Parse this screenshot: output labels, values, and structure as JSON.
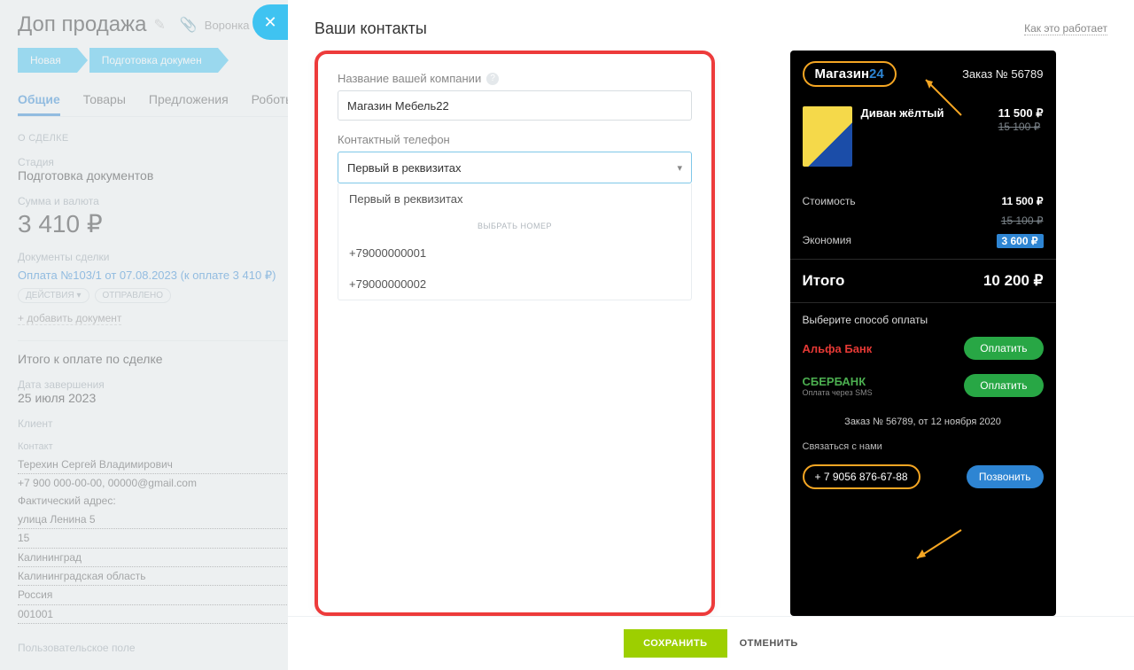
{
  "bg": {
    "title": "Доп продажа",
    "funnel": "Воронка отдела прода",
    "stages": [
      "Новая",
      "Подготовка докумен"
    ],
    "tabs": [
      "Общие",
      "Товары",
      "Предложения",
      "Роботы"
    ],
    "section": "О СДЕЛКЕ",
    "stage_lbl": "Стадия",
    "stage_val": "Подготовка документов",
    "sum_lbl": "Сумма и валюта",
    "sum_val": "3 410 ₽",
    "docs_lbl": "Документы сделки",
    "doc_link": "Оплата №103/1 от 07.08.2023 (к оплате 3 410 ₽)",
    "chip1": "ДЕЙСТВИЯ ▾",
    "chip2": "ОТПРАВЛЕНО",
    "add_doc": "+ добавить документ",
    "total_lbl": "Итого к оплате по сделке",
    "date_lbl": "Дата завершения",
    "date_val": "25 июля 2023",
    "client_lbl": "Клиент",
    "contact_lbl": "Контакт",
    "contact_name": "Терехин Сергей Владимирович",
    "contact_phone": "+7 900 000-00-00, 00000@gmail.com",
    "addr_lbl": "Фактический адрес:",
    "addr": [
      "улица Ленина 5",
      "15",
      "Калининград",
      "Калининградская область",
      "Россия",
      "001001"
    ],
    "custom_lbl": "Пользовательское поле"
  },
  "modal": {
    "title": "Ваши контакты",
    "how": "Как это работает",
    "company_lbl": "Название вашей компании",
    "company_val": "Магазин Мебель22",
    "phone_lbl": "Контактный телефон",
    "phone_sel": "Первый в реквизитах",
    "opts_header": "ВЫБРАТЬ НОМЕР",
    "opts": [
      "Первый в реквизитах",
      "+79000000001",
      "+79000000002"
    ],
    "save": "СОХРАНИТЬ",
    "cancel": "ОТМЕНИТЬ"
  },
  "preview": {
    "logo1": "Магазин",
    "logo2": "24",
    "order_no": "Заказ № 56789",
    "item_name": "Диван жёлтый",
    "item_price": "11 500 ₽",
    "item_old": "15 100 ₽",
    "cost_lbl": "Стоимость",
    "cost_val": "11 500 ₽",
    "cost_old": "15 100 ₽",
    "save_lbl": "Экономия",
    "save_val": "3 600 ₽",
    "total_lbl": "Итого",
    "total_val": "10 200 ₽",
    "paysel": "Выберите способ оплаты",
    "bank1": "Альфа Банк",
    "bank2": "СБЕРБАНК",
    "bank2_sub": "Оплата через SMS",
    "paybtn": "Оплатить",
    "order_line": "Заказ № 56789, от 12 ноября 2020",
    "contact_lbl": "Связаться с нами",
    "phone": "+ 7 9056 876-67-88",
    "call": "Позвонить"
  }
}
